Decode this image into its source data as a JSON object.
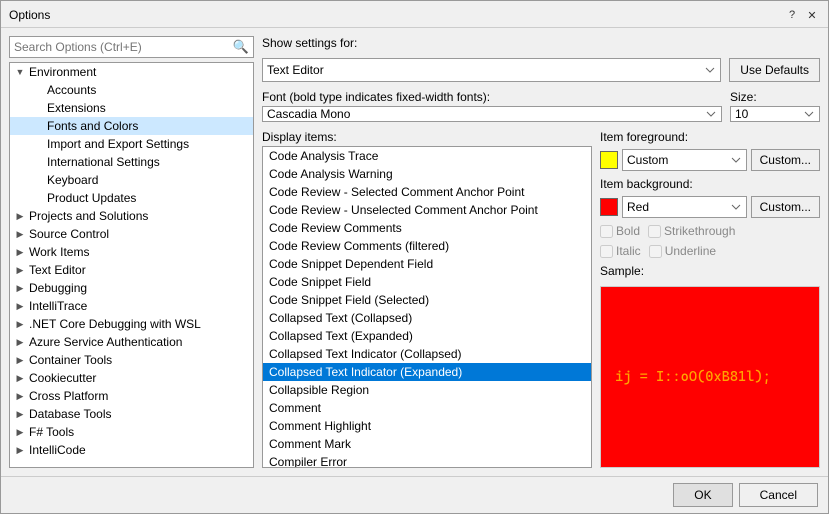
{
  "dialog": {
    "title": "Options",
    "titlebar_controls": [
      "?",
      "✕"
    ]
  },
  "search": {
    "placeholder": "Search Options (Ctrl+E)"
  },
  "tree": {
    "items": [
      {
        "label": "Environment",
        "level": 0,
        "arrow": "▼",
        "selected": false
      },
      {
        "label": "Accounts",
        "level": 1,
        "arrow": "",
        "selected": false
      },
      {
        "label": "Extensions",
        "level": 1,
        "arrow": "",
        "selected": false
      },
      {
        "label": "Fonts and Colors",
        "level": 1,
        "arrow": "",
        "selected": true
      },
      {
        "label": "Import and Export Settings",
        "level": 1,
        "arrow": "",
        "selected": false
      },
      {
        "label": "International Settings",
        "level": 1,
        "arrow": "",
        "selected": false
      },
      {
        "label": "Keyboard",
        "level": 1,
        "arrow": "",
        "selected": false
      },
      {
        "label": "Product Updates",
        "level": 1,
        "arrow": "",
        "selected": false
      },
      {
        "label": "Projects and Solutions",
        "level": 0,
        "arrow": "▶",
        "selected": false
      },
      {
        "label": "Source Control",
        "level": 0,
        "arrow": "▶",
        "selected": false
      },
      {
        "label": "Work Items",
        "level": 0,
        "arrow": "▶",
        "selected": false
      },
      {
        "label": "Text Editor",
        "level": 0,
        "arrow": "▶",
        "selected": false
      },
      {
        "label": "Debugging",
        "level": 0,
        "arrow": "▶",
        "selected": false
      },
      {
        "label": "IntelliTrace",
        "level": 0,
        "arrow": "▶",
        "selected": false
      },
      {
        "label": ".NET Core Debugging with WSL",
        "level": 0,
        "arrow": "▶",
        "selected": false
      },
      {
        "label": "Azure Service Authentication",
        "level": 0,
        "arrow": "▶",
        "selected": false
      },
      {
        "label": "Container Tools",
        "level": 0,
        "arrow": "▶",
        "selected": false
      },
      {
        "label": "Cookiecutter",
        "level": 0,
        "arrow": "▶",
        "selected": false
      },
      {
        "label": "Cross Platform",
        "level": 0,
        "arrow": "▶",
        "selected": false
      },
      {
        "label": "Database Tools",
        "level": 0,
        "arrow": "▶",
        "selected": false
      },
      {
        "label": "F# Tools",
        "level": 0,
        "arrow": "▶",
        "selected": false
      },
      {
        "label": "IntelliCode",
        "level": 0,
        "arrow": "▶",
        "selected": false
      }
    ]
  },
  "right": {
    "show_settings_label": "Show settings for:",
    "show_settings_value": "Text Editor",
    "use_defaults_label": "Use Defaults",
    "font_label": "Font (bold type indicates fixed-width fonts):",
    "font_value": "Cascadia Mono",
    "size_label": "Size:",
    "size_value": "10",
    "display_items_label": "Display items:",
    "display_items": [
      "Code Analysis Trace",
      "Code Analysis Warning",
      "Code Review - Selected Comment Anchor Point",
      "Code Review - Unselected Comment Anchor Point",
      "Code Review Comments",
      "Code Review Comments (filtered)",
      "Code Snippet Dependent Field",
      "Code Snippet Field",
      "Code Snippet Field (Selected)",
      "Collapsed Text (Collapsed)",
      "Collapsed Text (Expanded)",
      "Collapsed Text Indicator (Collapsed)",
      "Collapsed Text Indicator (Expanded)",
      "Collapsible Region",
      "Comment",
      "Comment Highlight",
      "Comment Mark",
      "Compiler Error"
    ],
    "selected_display_item": "Collapsed Text Indicator (Expanded)",
    "item_foreground_label": "Item foreground:",
    "item_foreground_color": "#FFFF00",
    "item_foreground_value": "Custom",
    "item_background_label": "Item background:",
    "item_background_color": "#FF0000",
    "item_background_value": "Red",
    "custom_btn_label": "Custom...",
    "bold_label": "Bold",
    "italic_label": "Italic",
    "strikethrough_label": "Strikethrough",
    "underline_label": "Underline",
    "sample_label": "Sample:",
    "sample_text": "ij = I::oO(0xB81l);",
    "sample_bg": "#FF0000",
    "sample_fg": "#FFA500"
  },
  "footer": {
    "ok_label": "OK",
    "cancel_label": "Cancel"
  }
}
